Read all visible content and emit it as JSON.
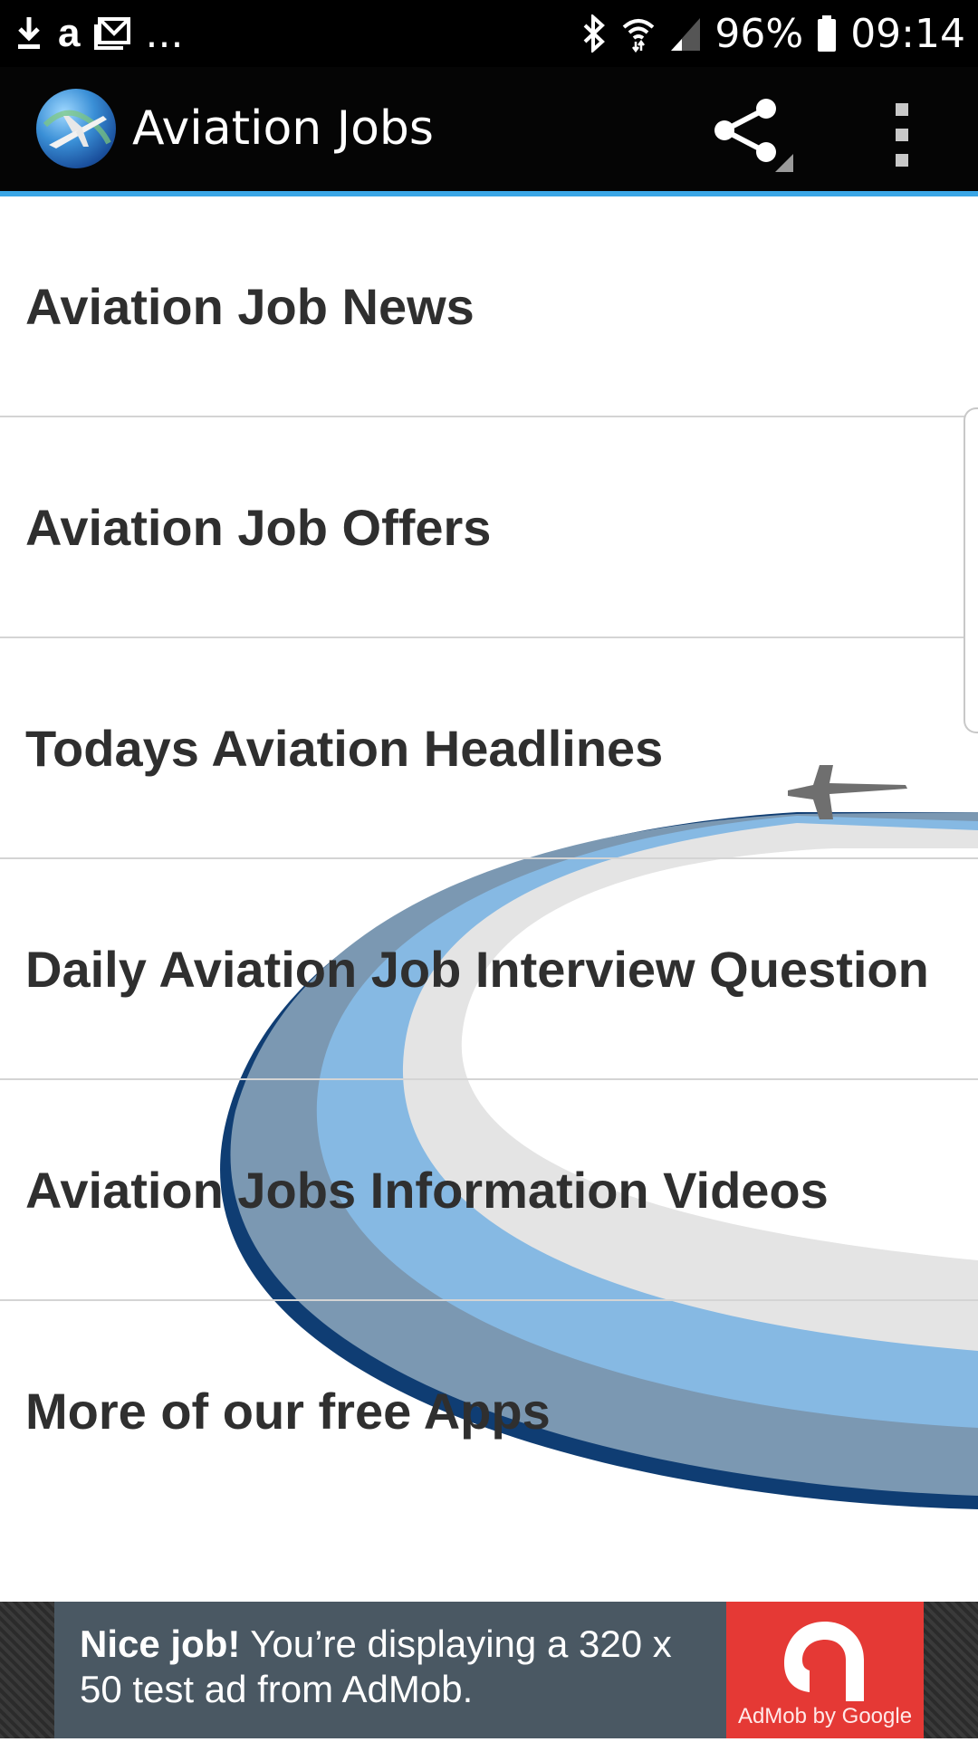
{
  "status_bar": {
    "left_icons": [
      "download-icon",
      "amazon-icon",
      "mail-icon"
    ],
    "overflow_dots": "...",
    "amazon_letter": "a",
    "battery": "96%",
    "time": "09:14",
    "right_icons": [
      "bluetooth-icon",
      "wifi-icon",
      "signal-icon",
      "battery-icon"
    ]
  },
  "app_bar": {
    "title": "Aviation Jobs",
    "actions": [
      "share-icon",
      "overflow-menu-icon"
    ],
    "accent_color": "#3aa6e6"
  },
  "menu": {
    "items": [
      {
        "label": "Aviation Job News"
      },
      {
        "label": "Aviation Job Offers"
      },
      {
        "label": "Todays Aviation Headlines"
      },
      {
        "label": "Daily Aviation Job Interview Question"
      },
      {
        "label": "Aviation Jobs Information Videos"
      },
      {
        "label": "More of our free Apps"
      }
    ]
  },
  "ad": {
    "headline": "Nice job!",
    "body": " You’re displaying a 320 x 50 test ad from AdMob.",
    "logo_caption": "AdMob by Google",
    "logo_color": "#e53935"
  }
}
